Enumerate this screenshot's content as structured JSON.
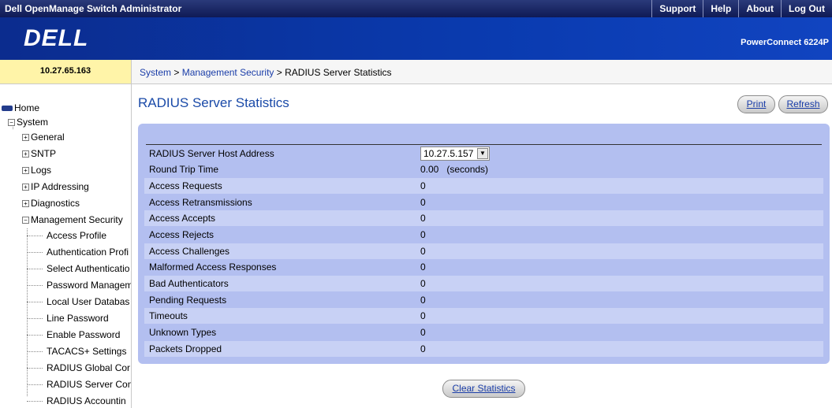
{
  "header": {
    "app_title": "Dell OpenManage Switch Administrator",
    "nav": [
      "Support",
      "Help",
      "About",
      "Log Out"
    ],
    "logo": "DELL",
    "model": "PowerConnect 6224P"
  },
  "ip_address": "10.27.65.163",
  "breadcrumb": {
    "system": "System",
    "sep1": " > ",
    "management_security": "Management Security",
    "sep2": " > ",
    "current": "RADIUS Server Statistics"
  },
  "sidebar": {
    "home": "Home",
    "system": "System",
    "groups": [
      "General",
      "SNTP",
      "Logs",
      "IP Addressing",
      "Diagnostics",
      "Management Security"
    ],
    "security_items": [
      "Access Profile",
      "Authentication Profi",
      "Select Authenticatio",
      "Password Managem",
      "Local User Databas",
      "Line Password",
      "Enable Password",
      "TACACS+ Settings",
      "RADIUS Global Cor",
      "RADIUS Server Con",
      "RADIUS Accountin"
    ]
  },
  "page": {
    "title": "RADIUS Server Statistics",
    "print_label": "Print",
    "refresh_label": "Refresh",
    "clear_label": "Clear Statistics"
  },
  "stats": {
    "host_label": "RADIUS Server Host Address",
    "host_value": "10.27.5.157",
    "rows": [
      {
        "label": "Round Trip Time",
        "value": "0.00   (seconds)"
      },
      {
        "label": "Access Requests",
        "value": "0"
      },
      {
        "label": "Access Retransmissions",
        "value": "0"
      },
      {
        "label": "Access Accepts",
        "value": "0"
      },
      {
        "label": "Access Rejects",
        "value": "0"
      },
      {
        "label": "Access Challenges",
        "value": "0"
      },
      {
        "label": "Malformed Access Responses",
        "value": "0"
      },
      {
        "label": "Bad Authenticators",
        "value": "0"
      },
      {
        "label": "Pending Requests",
        "value": "0"
      },
      {
        "label": "Timeouts",
        "value": "0"
      },
      {
        "label": "Unknown Types",
        "value": "0"
      },
      {
        "label": "Packets Dropped",
        "value": "0"
      }
    ]
  }
}
